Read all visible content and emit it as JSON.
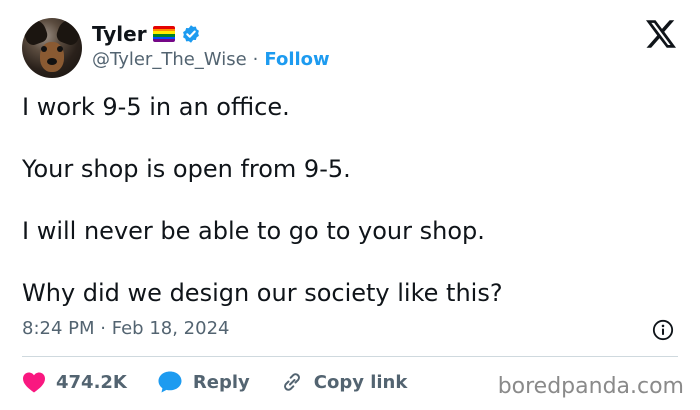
{
  "author": {
    "display_name": "Tyler",
    "handle": "@Tyler_The_Wise",
    "separator": "·",
    "follow_label": "Follow"
  },
  "flag_colors": [
    "#e40303",
    "#ff8c00",
    "#ffed00",
    "#008026",
    "#004dff",
    "#750787"
  ],
  "colors": {
    "accent": "#1d9bf0",
    "like": "#f91880",
    "muted": "#536471",
    "text": "#0f1419"
  },
  "tweet": {
    "lines": [
      "I work 9-5 in an office.",
      "Your shop is open from 9-5.",
      "I will never be able to go to your shop.",
      "Why did we design our society like this?"
    ],
    "time": "8:24 PM",
    "date": "Feb 18, 2024",
    "meta_separator": "·"
  },
  "actions": {
    "likes": "474.2K",
    "reply_label": "Reply",
    "copy_link_label": "Copy link"
  },
  "icons": [
    "heart-icon",
    "reply-bubble-icon",
    "link-icon",
    "info-icon",
    "x-logo-icon",
    "verified-badge-icon",
    "pride-flag-icon"
  ],
  "watermark": "boredpanda.com"
}
